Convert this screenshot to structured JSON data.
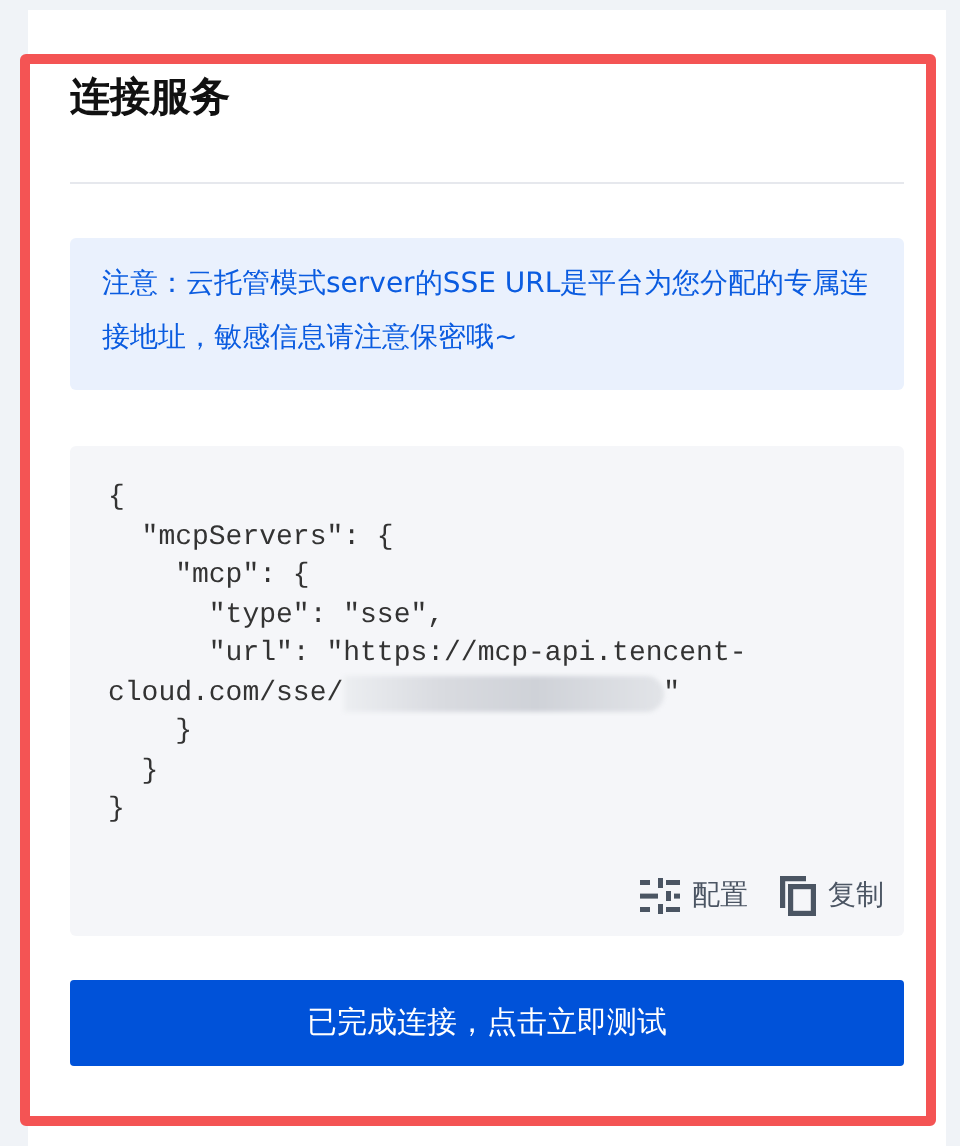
{
  "title": "连接服务",
  "notice": "注意：云托管模式server的SSE URL是平台为您分配的专属连接地址，敏感信息请注意保密哦~",
  "code_lines": [
    {
      "text": "{"
    },
    {
      "text": "  \"mcpServers\": {"
    },
    {
      "text": "    \"mcp\": {"
    },
    {
      "text": "      \"type\": \"sse\","
    },
    {
      "text": "      \"url\": \"https://mcp-api.tencent-"
    },
    {
      "text": "cloud.com/sse/",
      "redacted": true,
      "after": "\""
    },
    {
      "text": "    }"
    },
    {
      "text": "  }"
    },
    {
      "text": "}"
    }
  ],
  "actions": [
    {
      "kind": "config",
      "label": "配置"
    },
    {
      "kind": "copy",
      "label": "复制"
    }
  ],
  "primary_button": "已完成连接，点击立即测试",
  "highlight": true
}
